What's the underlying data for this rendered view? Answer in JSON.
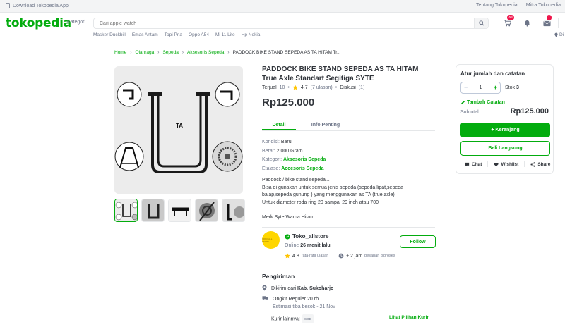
{
  "topbar": {
    "download_app": "Download Tokopedia App",
    "links": [
      "Tentang Tokopedia",
      "Mitra Tokopedia"
    ]
  },
  "header": {
    "logo": "tokopedia",
    "kategori": "Kategori",
    "search_placeholder": "Cari apple watch",
    "cart_count": "30",
    "inbox_count": "1",
    "suggestions": [
      "Masker Duckbill",
      "Emas Antam",
      "Topi Pria",
      "Oppo A54",
      "Mi 11 Lite",
      "Hp Nokia"
    ],
    "location": "Di"
  },
  "breadcrumb": {
    "items": [
      "Home",
      "Olahraga",
      "Sepeda",
      "Aksesoris Sepeda"
    ],
    "current": "PADDOCK BIKE STAND SEPEDA AS TA HITAM Tr..."
  },
  "product": {
    "image_label": "TA",
    "title": "PADDOCK BIKE STAND SEPEDA AS TA HITAM True Axle Standart Segitiga SYTE",
    "sold_label": "Terjual",
    "sold_count": "10",
    "rating": "4.7",
    "rating_count": "(7 ulasan)",
    "discussion_label": "Diskusi",
    "discussion_count": "(1)",
    "price": "Rp125.000"
  },
  "tabs": {
    "detail": "Detail",
    "info": "Info Penting"
  },
  "specs": {
    "kondisi_label": "Kondisi:",
    "kondisi": "Baru",
    "berat_label": "Berat:",
    "berat": "2.000 Gram",
    "kategori_label": "Kategori:",
    "kategori": "Aksesoris Sepeda",
    "etalase_label": "Etalase:",
    "etalase": "Accesoris Sepeda"
  },
  "description": {
    "lines": [
      "Paddock / bike stand sepeda...",
      "Bisa di gunakan untuk semua jenis sepeda (sepeda lipat,sepeda",
      "balap,sepeda gunung ) yang menggunakan as TA (true axle)",
      "Untuk diameter roda ring 20 sampai 29 inch atau 700",
      "",
      "Merk Syte Warna Hitam"
    ]
  },
  "shop": {
    "logo_text": "TOKO ALL STORE",
    "name": "Toko_allstore",
    "status_prefix": "Online",
    "status_time": "26 menit lalu",
    "follow": "Follow",
    "rating": "4.8",
    "rating_label": "rata-rata ulasan",
    "process_time": "± 2 jam",
    "process_label": "pesanan diproses"
  },
  "shipping": {
    "title": "Pengiriman",
    "from_prefix": "Dikirim dari",
    "from_city": "Kab. Sukoharjo",
    "service": "Ongkir Reguler 20 rb",
    "estimate": "Estimasi tiba besok - 21 Nov",
    "other_label": "Kurir lainnya:",
    "cod_badge": "COD",
    "see_options": "Lihat Pilihan Kurir"
  },
  "cart_card": {
    "title": "Atur jumlah dan catatan",
    "quantity": "1",
    "stock_label": "Stok",
    "stock_value": "3",
    "add_note": "Tambah Catatan",
    "subtotal_label": "Subtotal",
    "subtotal_value": "Rp125.000",
    "add_to_cart": "+ Keranjang",
    "buy_now": "Beli Langsung",
    "chat": "Chat",
    "wishlist": "Wishlist",
    "share": "Share"
  },
  "colors": {
    "brand_green": "#03ac0e",
    "badge_red": "#ef144a",
    "text_dark": "#31353b",
    "text_gray": "#6d7588"
  }
}
